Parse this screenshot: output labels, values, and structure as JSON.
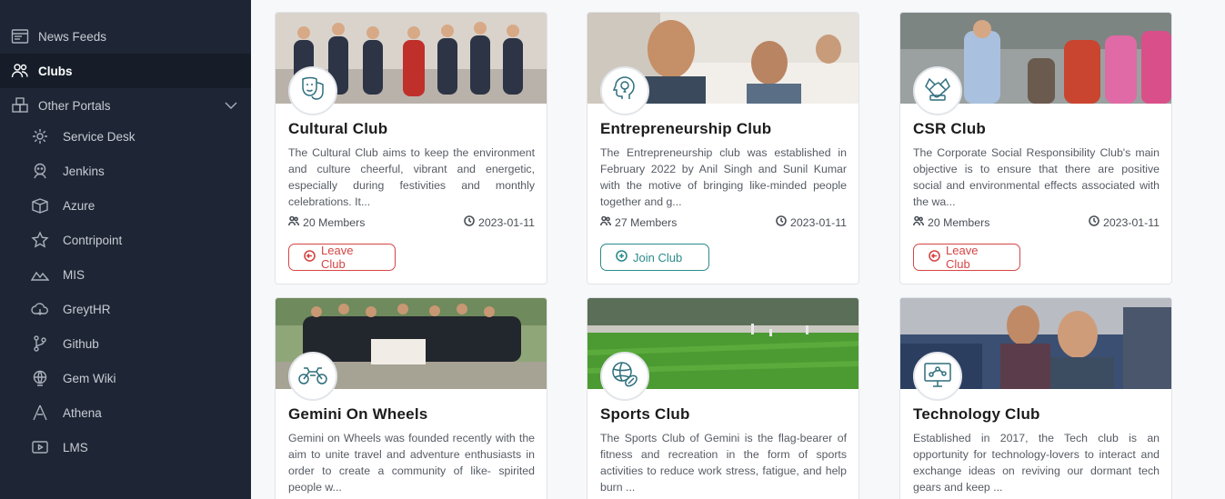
{
  "sidebar": {
    "items": [
      {
        "label": "News Feeds",
        "icon": "news-feed-icon"
      },
      {
        "label": "Clubs",
        "icon": "people-group-icon",
        "active": true
      },
      {
        "label": "Other Portals",
        "icon": "portals-icon",
        "expanded": true
      }
    ],
    "portals": [
      {
        "label": "Service Desk",
        "icon": "gear-icon"
      },
      {
        "label": "Jenkins",
        "icon": "jenkins-icon"
      },
      {
        "label": "Azure",
        "icon": "azure-icon"
      },
      {
        "label": "Contripoint",
        "icon": "star-icon"
      },
      {
        "label": "MIS",
        "icon": "mountain-chart-icon"
      },
      {
        "label": "GreytHR",
        "icon": "cloud-icon"
      },
      {
        "label": "Github",
        "icon": "git-branch-icon"
      },
      {
        "label": "Gem Wiki",
        "icon": "globe-icon"
      },
      {
        "label": "Athena",
        "icon": "triangle-icon"
      },
      {
        "label": "LMS",
        "icon": "video-screen-icon"
      }
    ]
  },
  "clubs": [
    {
      "title": "Cultural Club",
      "description": "The Cultural Club aims to keep the environment and culture cheerful, vibrant and energetic, especially during festivities and monthly celebrations. It...",
      "members": "20 Members",
      "date": "2023-01-11",
      "action": "Leave Club",
      "action_type": "leave",
      "icon": "theater-masks-icon"
    },
    {
      "title": "Entrepreneurship Club",
      "description": "The Entrepreneurship club was established in February 2022 by Anil Singh and Sunil Kumar with the motive of bringing like-minded people together and g...",
      "members": "27 Members",
      "date": "2023-01-11",
      "action": "Join Club",
      "action_type": "join",
      "icon": "lightbulb-head-icon"
    },
    {
      "title": "CSR Club",
      "description": "The Corporate Social Responsibility Club's main objective is to ensure that there are positive social and environmental effects associated with the wa...",
      "members": "20 Members",
      "date": "2023-01-11",
      "action": "Leave Club",
      "action_type": "leave",
      "icon": "handshake-icon"
    },
    {
      "title": "Gemini On Wheels",
      "description": "Gemini on Wheels was founded recently with the aim to unite travel and adventure enthusiasts in order to create a community of like- spirited people w...",
      "icon": "motorcycle-icon"
    },
    {
      "title": "Sports Club",
      "description": "The Sports Club of Gemini is the flag-bearer of fitness and recreation in the form of sports activities to reduce work stress, fatigue, and help burn ...",
      "icon": "sports-balls-icon"
    },
    {
      "title": "Technology Club",
      "description": "Established in 2017, the Tech club is an opportunity for technology-lovers to interact and exchange ideas on reviving our dormant tech gears and keep ...",
      "icon": "monitor-network-icon"
    }
  ],
  "colors": {
    "sidebar_bg": "#1e2635",
    "leave": "#d64545",
    "join": "#2b8a8a",
    "icon_teal": "#2e6f7d"
  }
}
